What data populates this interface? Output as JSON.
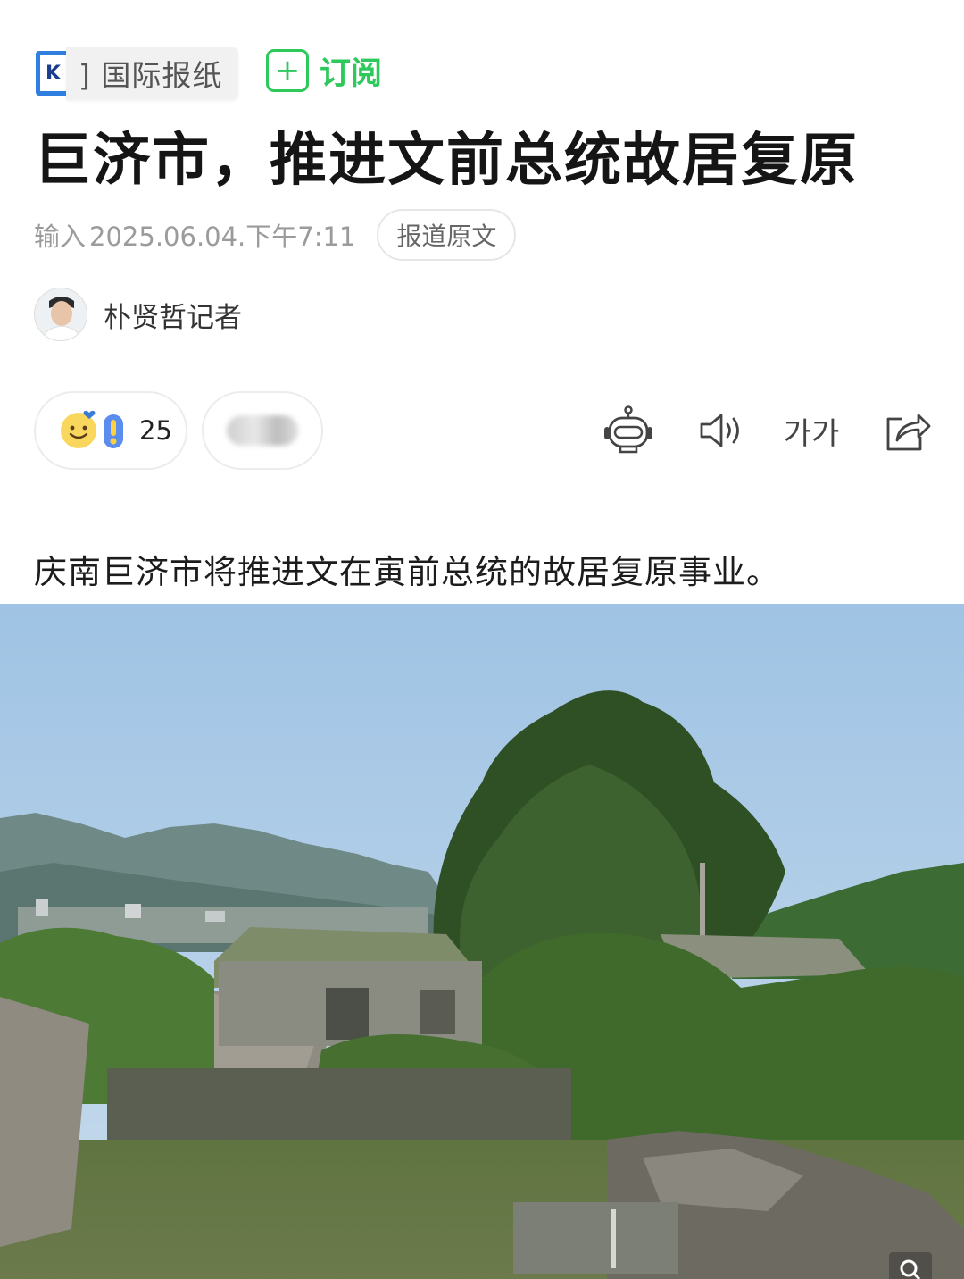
{
  "press": {
    "logo_letter": "K",
    "name": "] 国际报纸",
    "subscribe_label": "订阅",
    "subscribe_color": "#2ec95c"
  },
  "article": {
    "headline": "巨济市，推进文前总统故居复原",
    "meta_label": "输入",
    "date": "2025.06.04.下午7:11",
    "original_button": "报道原文",
    "reporter": "朴贤哲记者",
    "lead": "庆南巨济市将推进文在寅前总统的故居复原事业。"
  },
  "reactions": {
    "count": "25",
    "icons": [
      "smile-heart-icon",
      "exclamation-icon"
    ]
  },
  "toolbar": {
    "icons": [
      "robot-summary-icon",
      "speaker-icon",
      "font-size-icon",
      "share-icon"
    ],
    "font_size_label": "가가"
  },
  "photo": {
    "icon": "zoom-icon"
  }
}
